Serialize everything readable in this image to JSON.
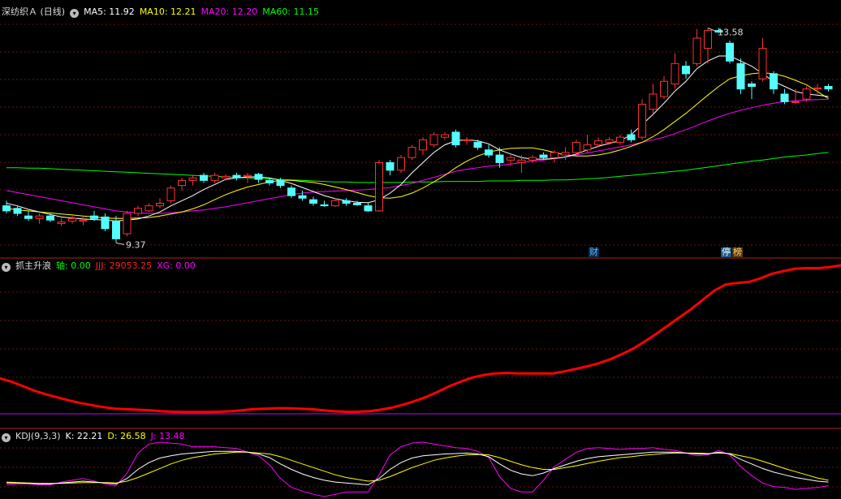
{
  "main": {
    "title": "深纺织Ａ (日线)",
    "ma5_label": "MA5: 11.92",
    "ma10_label": "MA10: 12.21",
    "ma20_label": "MA20: 12.20",
    "ma60_label": "MA60: 11.15",
    "high_label": "13.58",
    "low_label": "9.37",
    "badge_cai": "财",
    "badge_ting": "停",
    "badge_bang": "榜",
    "colors": {
      "up": "#ff3232",
      "down": "#54fcfc",
      "ma5": "#ffffff",
      "ma10": "#ffff00",
      "ma20": "#ff00ff",
      "ma60": "#00ff00",
      "grid": "#8b1a1a"
    }
  },
  "ind1": {
    "title": "抓主升浪",
    "axis_label": "轴: 0.00",
    "jjj_label": "JJJ: 29053.25",
    "xg_label": "XG: 0.00"
  },
  "ind2": {
    "title": "KDJ(9,3,3)",
    "k_label": "K: 22.21",
    "d_label": "D: 26.58",
    "j_label": "J: 13.48"
  },
  "chart_data": [
    {
      "type": "candlestick",
      "title": "深纺织Ａ (日线)",
      "ylim": [
        9.2,
        13.8
      ],
      "ohlc": [
        [
          10.1,
          10.2,
          9.95,
          10.0
        ],
        [
          10.05,
          10.1,
          9.9,
          9.95
        ],
        [
          9.9,
          10.0,
          9.8,
          9.85
        ],
        [
          9.85,
          9.95,
          9.75,
          9.9
        ],
        [
          9.9,
          9.95,
          9.78,
          9.82
        ],
        [
          9.75,
          9.85,
          9.7,
          9.78
        ],
        [
          9.8,
          9.9,
          9.75,
          9.85
        ],
        [
          9.8,
          9.9,
          9.72,
          9.82
        ],
        [
          9.9,
          10.0,
          9.8,
          9.85
        ],
        [
          9.88,
          9.95,
          9.6,
          9.65
        ],
        [
          9.8,
          9.9,
          9.37,
          9.45
        ],
        [
          9.55,
          10.0,
          9.5,
          9.95
        ],
        [
          9.95,
          10.1,
          9.9,
          10.05
        ],
        [
          10.0,
          10.15,
          9.98,
          10.1
        ],
        [
          10.1,
          10.25,
          10.05,
          10.15
        ],
        [
          10.2,
          10.5,
          10.15,
          10.45
        ],
        [
          10.5,
          10.65,
          10.4,
          10.6
        ],
        [
          10.6,
          10.7,
          10.5,
          10.65
        ],
        [
          10.7,
          10.75,
          10.55,
          10.6
        ],
        [
          10.6,
          10.75,
          10.55,
          10.7
        ],
        [
          10.65,
          10.72,
          10.6,
          10.68
        ],
        [
          10.7,
          10.75,
          10.6,
          10.65
        ],
        [
          10.68,
          10.75,
          10.55,
          10.7
        ],
        [
          10.72,
          10.75,
          10.55,
          10.62
        ],
        [
          10.6,
          10.65,
          10.5,
          10.55
        ],
        [
          10.6,
          10.65,
          10.45,
          10.5
        ],
        [
          10.45,
          10.5,
          10.25,
          10.3
        ],
        [
          10.3,
          10.4,
          10.2,
          10.25
        ],
        [
          10.22,
          10.28,
          10.1,
          10.15
        ],
        [
          10.12,
          10.2,
          10.08,
          10.1
        ],
        [
          10.1,
          10.25,
          10.08,
          10.2
        ],
        [
          10.2,
          10.25,
          10.1,
          10.15
        ],
        [
          10.15,
          10.2,
          10.1,
          10.12
        ],
        [
          10.1,
          10.15,
          9.98,
          10.0
        ],
        [
          10.0,
          11.0,
          9.98,
          10.95
        ],
        [
          10.95,
          11.0,
          10.7,
          10.8
        ],
        [
          10.8,
          11.1,
          10.75,
          11.05
        ],
        [
          11.05,
          11.3,
          11.0,
          11.25
        ],
        [
          11.2,
          11.45,
          11.1,
          11.4
        ],
        [
          11.3,
          11.55,
          11.25,
          11.5
        ],
        [
          11.45,
          11.55,
          11.4,
          11.5
        ],
        [
          11.55,
          11.6,
          11.25,
          11.3
        ],
        [
          11.4,
          11.45,
          11.3,
          11.4
        ],
        [
          11.35,
          11.4,
          11.2,
          11.25
        ],
        [
          11.2,
          11.3,
          11.05,
          11.1
        ],
        [
          11.1,
          11.25,
          10.85,
          10.95
        ],
        [
          11.0,
          11.1,
          10.9,
          11.05
        ],
        [
          10.95,
          11.1,
          10.75,
          11.0
        ],
        [
          11.0,
          11.1,
          10.95,
          11.05
        ],
        [
          11.1,
          11.15,
          11.0,
          11.05
        ],
        [
          11.05,
          11.2,
          10.95,
          11.15
        ],
        [
          11.1,
          11.25,
          11.0,
          11.15
        ],
        [
          11.15,
          11.4,
          11.1,
          11.35
        ],
        [
          11.2,
          11.5,
          11.15,
          11.3
        ],
        [
          11.3,
          11.45,
          11.25,
          11.38
        ],
        [
          11.35,
          11.45,
          11.3,
          11.4
        ],
        [
          11.35,
          11.5,
          11.3,
          11.45
        ],
        [
          11.5,
          11.6,
          11.35,
          11.4
        ],
        [
          11.45,
          12.2,
          11.4,
          12.1
        ],
        [
          12.0,
          12.5,
          11.9,
          12.3
        ],
        [
          12.25,
          12.65,
          12.2,
          12.55
        ],
        [
          12.5,
          13.1,
          12.4,
          12.9
        ],
        [
          12.85,
          12.95,
          12.6,
          12.7
        ],
        [
          12.9,
          13.58,
          12.85,
          13.4
        ],
        [
          13.2,
          13.6,
          12.9,
          13.55
        ],
        [
          13.55,
          13.6,
          13.5,
          13.52
        ],
        [
          13.3,
          13.35,
          12.9,
          12.95
        ],
        [
          12.9,
          13.0,
          12.3,
          12.4
        ],
        [
          12.5,
          12.55,
          12.2,
          12.45
        ],
        [
          12.6,
          13.4,
          12.55,
          13.2
        ],
        [
          12.7,
          12.75,
          12.3,
          12.4
        ],
        [
          12.3,
          12.4,
          12.1,
          12.15
        ],
        [
          12.15,
          12.4,
          12.1,
          12.15
        ],
        [
          12.2,
          12.45,
          12.15,
          12.4
        ],
        [
          12.4,
          12.5,
          12.3,
          12.42
        ],
        [
          12.45,
          12.5,
          12.35,
          12.4
        ]
      ],
      "ma5": [
        10.15,
        10.1,
        10.03,
        9.98,
        9.93,
        9.88,
        9.86,
        9.84,
        9.83,
        9.82,
        9.8,
        9.82,
        9.84,
        9.9,
        9.98,
        10.1,
        10.2,
        10.3,
        10.42,
        10.52,
        10.62,
        10.65,
        10.67,
        10.67,
        10.65,
        10.6,
        10.54,
        10.46,
        10.38,
        10.3,
        10.24,
        10.2,
        10.17,
        10.16,
        10.22,
        10.35,
        10.52,
        10.75,
        10.95,
        11.15,
        11.3,
        11.38,
        11.4,
        11.38,
        11.32,
        11.2,
        11.12,
        11.05,
        11.02,
        11.02,
        11.03,
        11.06,
        11.12,
        11.2,
        11.27,
        11.33,
        11.38,
        11.5,
        11.7,
        11.9,
        12.12,
        12.36,
        12.55,
        12.8,
        12.95,
        13.05,
        13.05,
        12.95,
        12.85,
        12.7,
        12.55,
        12.45,
        12.35,
        12.3,
        12.28,
        12.25
      ],
      "ma10": [
        10.05,
        10.02,
        10.0,
        9.98,
        9.96,
        9.94,
        9.92,
        9.9,
        9.88,
        9.86,
        9.85,
        9.85,
        9.86,
        9.87,
        9.9,
        9.94,
        9.98,
        10.04,
        10.12,
        10.22,
        10.32,
        10.4,
        10.47,
        10.52,
        10.57,
        10.6,
        10.6,
        10.58,
        10.56,
        10.52,
        10.47,
        10.42,
        10.36,
        10.3,
        10.26,
        10.25,
        10.28,
        10.35,
        10.45,
        10.57,
        10.7,
        10.85,
        10.98,
        11.08,
        11.16,
        11.2,
        11.23,
        11.24,
        11.24,
        11.2,
        11.15,
        11.1,
        11.08,
        11.08,
        11.1,
        11.14,
        11.2,
        11.27,
        11.35,
        11.46,
        11.6,
        11.76,
        11.92,
        12.1,
        12.28,
        12.45,
        12.6,
        12.66,
        12.7,
        12.72,
        12.7,
        12.65,
        12.57,
        12.48,
        12.35,
        12.21
      ],
      "ma20": [
        10.4,
        10.36,
        10.32,
        10.28,
        10.24,
        10.2,
        10.16,
        10.12,
        10.08,
        10.04,
        10.0,
        9.98,
        9.96,
        9.95,
        9.95,
        9.96,
        9.98,
        10.0,
        10.02,
        10.05,
        10.08,
        10.12,
        10.16,
        10.2,
        10.24,
        10.28,
        10.32,
        10.35,
        10.37,
        10.38,
        10.39,
        10.4,
        10.41,
        10.42,
        10.44,
        10.46,
        10.5,
        10.54,
        10.6,
        10.66,
        10.72,
        10.78,
        10.82,
        10.85,
        10.88,
        10.9,
        10.92,
        10.95,
        10.98,
        11.0,
        11.03,
        11.06,
        11.1,
        11.14,
        11.18,
        11.22,
        11.26,
        11.3,
        11.35,
        11.4,
        11.45,
        11.52,
        11.6,
        11.68,
        11.77,
        11.85,
        11.92,
        11.98,
        12.03,
        12.08,
        12.12,
        12.15,
        12.17,
        12.18,
        12.19,
        12.2
      ],
      "ma60": [
        10.85,
        10.85,
        10.84,
        10.84,
        10.83,
        10.82,
        10.81,
        10.8,
        10.79,
        10.78,
        10.77,
        10.76,
        10.75,
        10.74,
        10.73,
        10.72,
        10.71,
        10.7,
        10.69,
        10.68,
        10.67,
        10.66,
        10.65,
        10.64,
        10.63,
        10.62,
        10.61,
        10.6,
        10.59,
        10.58,
        10.57,
        10.57,
        10.56,
        10.56,
        10.56,
        10.56,
        10.56,
        10.57,
        10.57,
        10.57,
        10.58,
        10.58,
        10.58,
        10.58,
        10.59,
        10.59,
        10.59,
        10.6,
        10.6,
        10.6,
        10.61,
        10.61,
        10.62,
        10.63,
        10.64,
        10.66,
        10.68,
        10.7,
        10.72,
        10.74,
        10.76,
        10.78,
        10.8,
        10.83,
        10.86,
        10.89,
        10.92,
        10.95,
        10.98,
        11.0,
        11.03,
        11.06,
        11.08,
        11.1,
        11.13,
        11.15
      ],
      "annotations": [
        "13.58",
        "9.37"
      ]
    },
    {
      "type": "line",
      "title": "抓主升浪",
      "ylim": [
        0,
        30000
      ],
      "series": [
        {
          "name": "JJJ",
          "color": "#ff0000",
          "values": [
            6900,
            6300,
            5400,
            4500,
            3800,
            3200,
            2600,
            2100,
            1700,
            1300,
            1000,
            900,
            800,
            700,
            500,
            400,
            350,
            350,
            350,
            400,
            500,
            700,
            900,
            1000,
            1100,
            1100,
            1000,
            900,
            700,
            500,
            400,
            400,
            500,
            800,
            1200,
            1800,
            2500,
            3300,
            4300,
            5400,
            6300,
            7100,
            7600,
            7900,
            8000,
            7900,
            7900,
            7900,
            7900,
            8300,
            8800,
            9300,
            9900,
            10700,
            11700,
            12800,
            14200,
            15700,
            17300,
            18900,
            20500,
            22300,
            24100,
            25300,
            25600,
            25800,
            26500,
            27400,
            27900,
            28400,
            28500,
            28500,
            28700,
            29053
          ]
        },
        {
          "name": "轴",
          "color": "#cc00ff",
          "values": [
            0
          ]
        }
      ]
    },
    {
      "type": "line",
      "title": "KDJ(9,3,3)",
      "ylim": [
        -10,
        110
      ],
      "series": [
        {
          "name": "K",
          "color": "#ffffff",
          "values": [
            20,
            20,
            19,
            18,
            18,
            20,
            22,
            24,
            22,
            20,
            18,
            30,
            50,
            65,
            75,
            80,
            84,
            86,
            88,
            90,
            90,
            90,
            88,
            84,
            76,
            62,
            50,
            40,
            32,
            26,
            22,
            20,
            18,
            16,
            30,
            50,
            65,
            75,
            80,
            82,
            84,
            85,
            86,
            84,
            78,
            62,
            48,
            40,
            36,
            42,
            52,
            60,
            68,
            74,
            78,
            80,
            82,
            84,
            86,
            88,
            88,
            88,
            86,
            84,
            84,
            88,
            84,
            72,
            62,
            52,
            44,
            38,
            32,
            28,
            24,
            22
          ]
        },
        {
          "name": "D",
          "color": "#ffff00",
          "values": [
            22,
            21,
            20,
            19,
            19,
            19,
            20,
            21,
            21,
            21,
            20,
            24,
            32,
            42,
            52,
            62,
            70,
            76,
            80,
            84,
            86,
            88,
            88,
            86,
            84,
            78,
            70,
            62,
            54,
            46,
            38,
            32,
            28,
            24,
            26,
            34,
            44,
            54,
            62,
            70,
            75,
            79,
            82,
            83,
            82,
            76,
            68,
            60,
            54,
            50,
            50,
            54,
            58,
            63,
            68,
            72,
            76,
            78,
            81,
            83,
            85,
            86,
            86,
            86,
            85,
            86,
            85,
            80,
            75,
            68,
            60,
            52,
            45,
            38,
            31,
            26
          ]
        },
        {
          "name": "J",
          "color": "#ff00ff",
          "values": [
            16,
            18,
            18,
            16,
            16,
            22,
            26,
            30,
            24,
            18,
            14,
            42,
            86,
            106,
            110,
            108,
            106,
            100,
            100,
            100,
            98,
            96,
            88,
            80,
            60,
            30,
            10,
            2,
            -5,
            -10,
            -5,
            0,
            0,
            0,
            38,
            82,
            100,
            108,
            110,
            106,
            102,
            98,
            96,
            90,
            76,
            34,
            8,
            0,
            0,
            26,
            56,
            72,
            88,
            96,
            98,
            96,
            94,
            96,
            96,
            98,
            94,
            92,
            86,
            80,
            82,
            92,
            82,
            56,
            36,
            20,
            12,
            10,
            6,
            8,
            10,
            14
          ]
        }
      ]
    }
  ]
}
